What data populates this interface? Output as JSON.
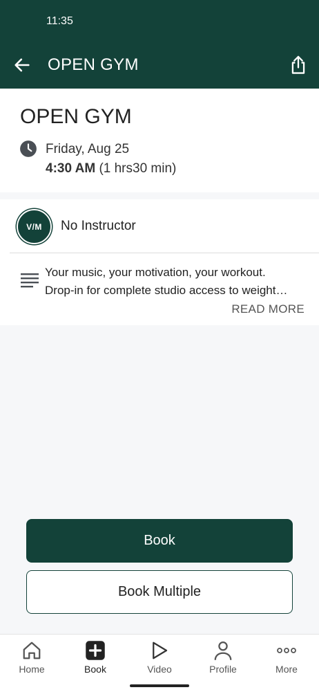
{
  "status_bar": {
    "time": "11:35"
  },
  "app_bar": {
    "title": "OPEN GYM"
  },
  "class": {
    "title": "OPEN GYM",
    "date": "Friday, Aug 25",
    "start_time": "4:30 AM",
    "duration": "(1 hrs30 min)"
  },
  "instructor": {
    "avatar_text": "V/M",
    "name": "No Instructor"
  },
  "description": {
    "line1": "Your music, your motivation, your workout.",
    "line2": "Drop-in for complete studio access to weight…",
    "read_more": "READ MORE"
  },
  "actions": {
    "book": "Book",
    "book_multiple": "Book Multiple"
  },
  "nav": [
    {
      "label": "Home",
      "icon": "home-icon"
    },
    {
      "label": "Book",
      "icon": "book-plus-icon"
    },
    {
      "label": "Video",
      "icon": "play-icon"
    },
    {
      "label": "Profile",
      "icon": "person-icon"
    },
    {
      "label": "More",
      "icon": "more-dots-icon"
    }
  ],
  "colors": {
    "brand": "#134239"
  }
}
